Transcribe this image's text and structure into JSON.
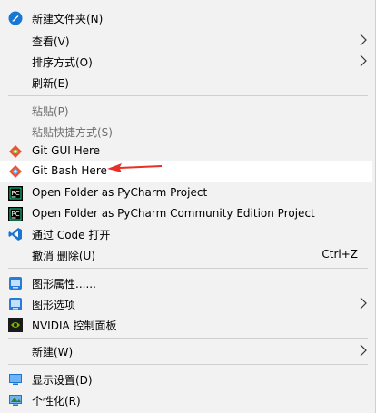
{
  "menu": {
    "new_folder": "新建文件夹(N)",
    "view": "查看(V)",
    "sort": "排序方式(O)",
    "refresh": "刷新(E)",
    "paste": "粘贴(P)",
    "paste_shortcut": "粘贴快捷方式(S)",
    "git_gui": "Git GUI Here",
    "git_bash": "Git Bash Here",
    "pycharm_open": "Open Folder as PyCharm Project",
    "pycharm_community": "Open Folder as PyCharm Community Edition Project",
    "vscode_open": "通过 Code 打开",
    "undo_delete": "撤消 删除(U)",
    "undo_shortcut": "Ctrl+Z",
    "graphics_props": "图形属性......",
    "graphics_options": "图形选项",
    "nvidia": "NVIDIA 控制面板",
    "new": "新建(W)",
    "display": "显示设置(D)",
    "personalize": "个性化(R)"
  },
  "colors": {
    "arrow_red": "#e8302a",
    "accent_blue": "#1976d2",
    "git_orange": "#f05033",
    "nvidia_green": "#76b900"
  }
}
